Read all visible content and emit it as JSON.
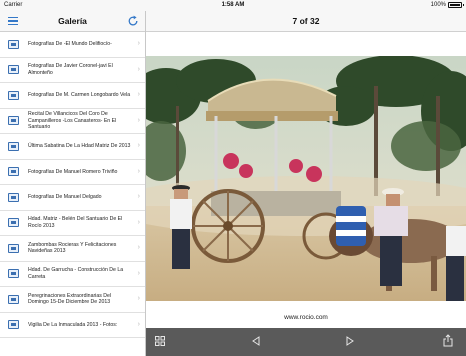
{
  "status_bar": {
    "carrier": "Carrier",
    "time": "1:58 AM",
    "battery": "100%"
  },
  "sidebar": {
    "title": "Galería",
    "items": [
      {
        "label": "Fotografías De -El Mundo Delifiocío-"
      },
      {
        "label": "Fotografías De Javier Coronel-javi El Almonteño"
      },
      {
        "label": "Fotografías De M. Carmen Longobardo Vela"
      },
      {
        "label": "Recital De Villancicos Del Coro De Campanilleros -Los Canasteros- En El Santuario"
      },
      {
        "label": "Última Sabatina De La Hdad Matriz De 2013"
      },
      {
        "label": "Fotografías De Manuel Romero Triviño"
      },
      {
        "label": "Fotografías De Manuel Delgado"
      },
      {
        "label": "Hdad. Matriz - Belén Del Santuario De El Rocío 2013"
      },
      {
        "label": "Zambombas Rocieras Y Felicitaciones Navideñas 2013"
      },
      {
        "label": "Hdad. De Garrucha - Construcción De La Carreta"
      },
      {
        "label": "Peregrinaciones Extraordinarias Del Domingo 15-De Diciembre De 2013"
      },
      {
        "label": "Vigilia De La Inmaculada 2013 - Fotos:"
      }
    ]
  },
  "main": {
    "counter": "7 of 32",
    "caption": "www.rocio.com"
  },
  "icons": {
    "menu": "hamburger-menu-icon",
    "refresh": "refresh-icon",
    "grid": "grid-icon",
    "prev": "previous-triangle-icon",
    "next": "next-triangle-icon",
    "share": "share-icon"
  },
  "colors": {
    "accent": "#3478c8",
    "toolbar": "#5a5a5a"
  }
}
